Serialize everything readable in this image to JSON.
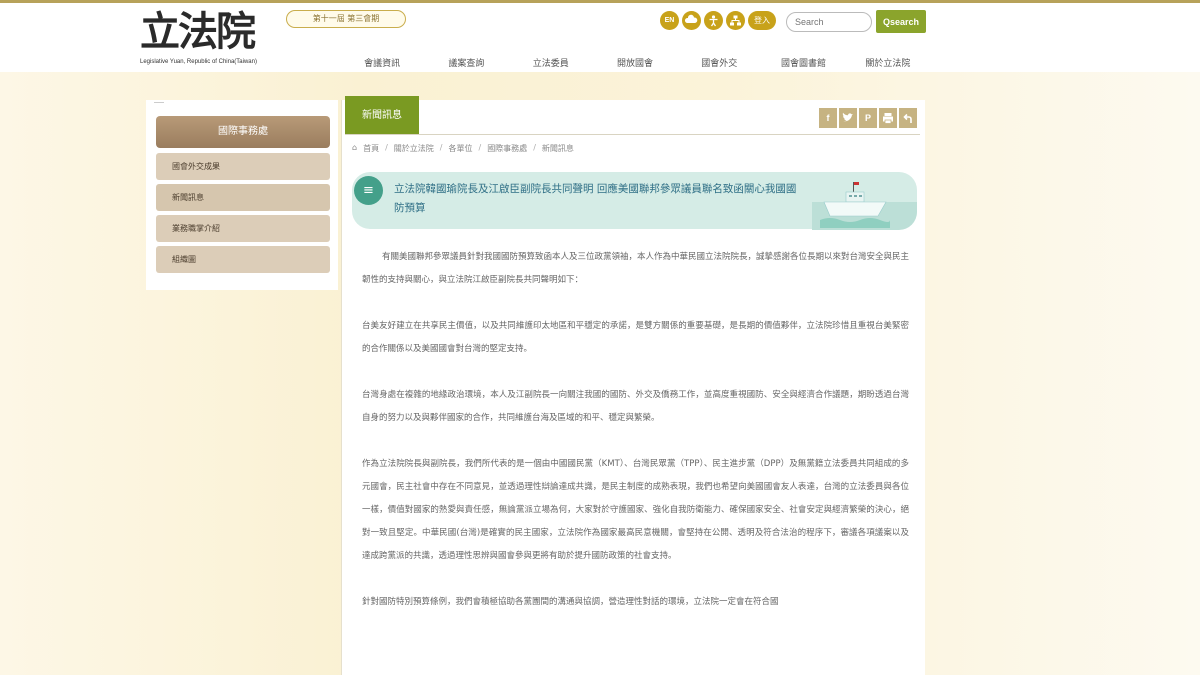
{
  "header": {
    "logo_text": "立法院",
    "logo_sub": "Legislative Yuan, Republic of China(Taiwan)",
    "session": "第十一屆 第三會期",
    "icons": [
      {
        "label": "EN",
        "name": "english-icon"
      },
      {
        "label": "",
        "name": "cloud-icon"
      },
      {
        "label": "",
        "name": "accessibility-icon"
      },
      {
        "label": "",
        "name": "sitemap-icon"
      }
    ],
    "login_label": "登入",
    "search_placeholder": "Search",
    "search_button": "Qsearch",
    "nav": [
      "會議資訊",
      "議案查詢",
      "立法委員",
      "開放國會",
      "國會外交",
      "國會圖書館",
      "關於立法院"
    ]
  },
  "sidebar": {
    "heading": "國際事務處",
    "items": [
      "國會外交成果",
      "新聞訊息",
      "業務職掌介紹",
      "組織圖"
    ]
  },
  "content": {
    "tab_label": "新聞訊息",
    "share_icons": [
      {
        "glyph": "f",
        "name": "facebook-icon"
      },
      {
        "glyph": "🐦",
        "name": "twitter-icon"
      },
      {
        "glyph": "P",
        "name": "plurk-icon"
      },
      {
        "glyph": "🖶",
        "name": "print-icon"
      },
      {
        "glyph": "↰",
        "name": "back-icon"
      }
    ],
    "breadcrumb": [
      "首頁",
      "關於立法院",
      "各單位",
      "國際事務處",
      "新聞訊息"
    ],
    "title": "立法院韓國瑜院長及江啟臣副院長共同聲明 回應美國聯邦參眾議員聯名致函關心我國國防預算",
    "paragraphs": [
      "有關美國聯邦參眾議員針對我國國防預算致函本人及三位政黨領袖，本人作為中華民國立法院院長，誠摯感謝各位長期以來對台灣安全與民主韌性的支持與關心，與立法院江啟臣副院長共同聲明如下：",
      "台美友好建立在共享民主價值，以及共同維護印太地區和平穩定的承諾，是雙方關係的重要基礎，是長期的價值夥伴，立法院珍惜且重視台美緊密的合作關係以及美國國會對台灣的堅定支持。",
      "台灣身處在複雜的地緣政治環境，本人及江副院長一向關注我國的國防、外交及僑務工作，並高度重視國防、安全與經濟合作議題，期盼透過台灣自身的努力以及與夥伴國家的合作，共同維護台海及區域的和平、穩定與繁榮。",
      "作為立法院院長與副院長，我們所代表的是一個由中國國民黨（KMT）、台灣民眾黨（TPP）、民主進步黨（DPP）及無黨籍立法委員共同組成的多元國會，民主社會中存在不同意見，並透過理性辯論達成共識，是民主制度的成熟表現，我們也希望向美國國會友人表達，台灣的立法委員與各位一樣，價值對國家的熱愛與責任感，無論黨派立場為何，大家對於守護國家、強化自我防衛能力、確保國家安全、社會安定與經濟繁榮的決心，絕對一致且堅定。中華民國(台灣)是確實的民主國家，立法院作為國家最高民意機關，會堅持在公開、透明及符合法治的程序下，審議各項議案以及達成跨黨派的共識，透過理性思辨與國會參與更將有助於提升國防政策的社會支持。",
      "針對國防特別預算條例，我們會積極協助各黨團間的溝通與協調，營造理性對話的環境，立法院一定會在符合國"
    ]
  }
}
